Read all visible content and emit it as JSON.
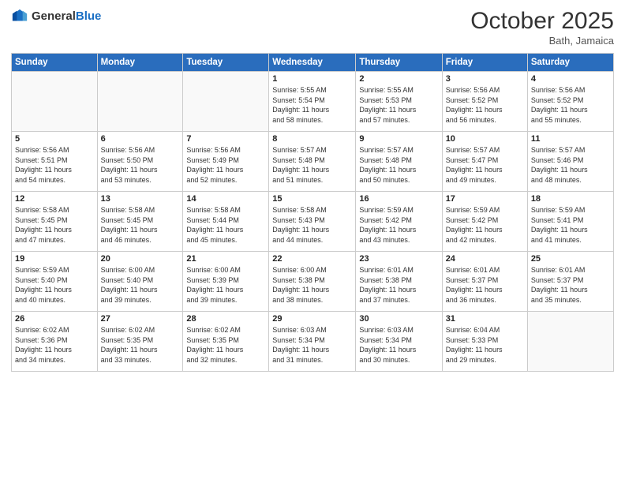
{
  "header": {
    "logo_general": "General",
    "logo_blue": "Blue",
    "month": "October 2025",
    "location": "Bath, Jamaica"
  },
  "weekdays": [
    "Sunday",
    "Monday",
    "Tuesday",
    "Wednesday",
    "Thursday",
    "Friday",
    "Saturday"
  ],
  "weeks": [
    [
      {
        "day": "",
        "info": ""
      },
      {
        "day": "",
        "info": ""
      },
      {
        "day": "",
        "info": ""
      },
      {
        "day": "1",
        "info": "Sunrise: 5:55 AM\nSunset: 5:54 PM\nDaylight: 11 hours\nand 58 minutes."
      },
      {
        "day": "2",
        "info": "Sunrise: 5:55 AM\nSunset: 5:53 PM\nDaylight: 11 hours\nand 57 minutes."
      },
      {
        "day": "3",
        "info": "Sunrise: 5:56 AM\nSunset: 5:52 PM\nDaylight: 11 hours\nand 56 minutes."
      },
      {
        "day": "4",
        "info": "Sunrise: 5:56 AM\nSunset: 5:52 PM\nDaylight: 11 hours\nand 55 minutes."
      }
    ],
    [
      {
        "day": "5",
        "info": "Sunrise: 5:56 AM\nSunset: 5:51 PM\nDaylight: 11 hours\nand 54 minutes."
      },
      {
        "day": "6",
        "info": "Sunrise: 5:56 AM\nSunset: 5:50 PM\nDaylight: 11 hours\nand 53 minutes."
      },
      {
        "day": "7",
        "info": "Sunrise: 5:56 AM\nSunset: 5:49 PM\nDaylight: 11 hours\nand 52 minutes."
      },
      {
        "day": "8",
        "info": "Sunrise: 5:57 AM\nSunset: 5:48 PM\nDaylight: 11 hours\nand 51 minutes."
      },
      {
        "day": "9",
        "info": "Sunrise: 5:57 AM\nSunset: 5:48 PM\nDaylight: 11 hours\nand 50 minutes."
      },
      {
        "day": "10",
        "info": "Sunrise: 5:57 AM\nSunset: 5:47 PM\nDaylight: 11 hours\nand 49 minutes."
      },
      {
        "day": "11",
        "info": "Sunrise: 5:57 AM\nSunset: 5:46 PM\nDaylight: 11 hours\nand 48 minutes."
      }
    ],
    [
      {
        "day": "12",
        "info": "Sunrise: 5:58 AM\nSunset: 5:45 PM\nDaylight: 11 hours\nand 47 minutes."
      },
      {
        "day": "13",
        "info": "Sunrise: 5:58 AM\nSunset: 5:45 PM\nDaylight: 11 hours\nand 46 minutes."
      },
      {
        "day": "14",
        "info": "Sunrise: 5:58 AM\nSunset: 5:44 PM\nDaylight: 11 hours\nand 45 minutes."
      },
      {
        "day": "15",
        "info": "Sunrise: 5:58 AM\nSunset: 5:43 PM\nDaylight: 11 hours\nand 44 minutes."
      },
      {
        "day": "16",
        "info": "Sunrise: 5:59 AM\nSunset: 5:42 PM\nDaylight: 11 hours\nand 43 minutes."
      },
      {
        "day": "17",
        "info": "Sunrise: 5:59 AM\nSunset: 5:42 PM\nDaylight: 11 hours\nand 42 minutes."
      },
      {
        "day": "18",
        "info": "Sunrise: 5:59 AM\nSunset: 5:41 PM\nDaylight: 11 hours\nand 41 minutes."
      }
    ],
    [
      {
        "day": "19",
        "info": "Sunrise: 5:59 AM\nSunset: 5:40 PM\nDaylight: 11 hours\nand 40 minutes."
      },
      {
        "day": "20",
        "info": "Sunrise: 6:00 AM\nSunset: 5:40 PM\nDaylight: 11 hours\nand 39 minutes."
      },
      {
        "day": "21",
        "info": "Sunrise: 6:00 AM\nSunset: 5:39 PM\nDaylight: 11 hours\nand 39 minutes."
      },
      {
        "day": "22",
        "info": "Sunrise: 6:00 AM\nSunset: 5:38 PM\nDaylight: 11 hours\nand 38 minutes."
      },
      {
        "day": "23",
        "info": "Sunrise: 6:01 AM\nSunset: 5:38 PM\nDaylight: 11 hours\nand 37 minutes."
      },
      {
        "day": "24",
        "info": "Sunrise: 6:01 AM\nSunset: 5:37 PM\nDaylight: 11 hours\nand 36 minutes."
      },
      {
        "day": "25",
        "info": "Sunrise: 6:01 AM\nSunset: 5:37 PM\nDaylight: 11 hours\nand 35 minutes."
      }
    ],
    [
      {
        "day": "26",
        "info": "Sunrise: 6:02 AM\nSunset: 5:36 PM\nDaylight: 11 hours\nand 34 minutes."
      },
      {
        "day": "27",
        "info": "Sunrise: 6:02 AM\nSunset: 5:35 PM\nDaylight: 11 hours\nand 33 minutes."
      },
      {
        "day": "28",
        "info": "Sunrise: 6:02 AM\nSunset: 5:35 PM\nDaylight: 11 hours\nand 32 minutes."
      },
      {
        "day": "29",
        "info": "Sunrise: 6:03 AM\nSunset: 5:34 PM\nDaylight: 11 hours\nand 31 minutes."
      },
      {
        "day": "30",
        "info": "Sunrise: 6:03 AM\nSunset: 5:34 PM\nDaylight: 11 hours\nand 30 minutes."
      },
      {
        "day": "31",
        "info": "Sunrise: 6:04 AM\nSunset: 5:33 PM\nDaylight: 11 hours\nand 29 minutes."
      },
      {
        "day": "",
        "info": ""
      }
    ]
  ]
}
